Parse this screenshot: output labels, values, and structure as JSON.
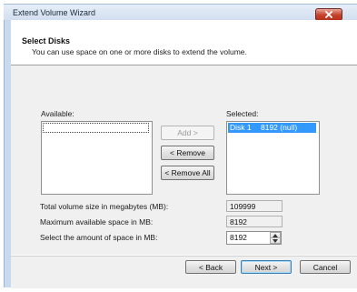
{
  "window": {
    "title": "Extend Volume Wizard"
  },
  "header": {
    "title": "Select Disks",
    "description": "You can use space on one or more disks to extend the volume."
  },
  "available": {
    "label": "Available:",
    "items": []
  },
  "selected": {
    "label": "Selected:",
    "items": [
      {
        "disk": "Disk 1",
        "size": "8192 (null)"
      }
    ]
  },
  "buttons": {
    "add": "Add >",
    "remove": "< Remove",
    "remove_all": "< Remove All",
    "back": "< Back",
    "next": "Next >",
    "cancel": "Cancel"
  },
  "fields": {
    "total_label": "Total volume size in megabytes (MB):",
    "total_value": "109999",
    "max_label": "Maximum available space in MB:",
    "max_value": "8192",
    "amount_label": "Select the amount of space in MB:",
    "amount_value": "8192"
  },
  "icons": {
    "close": "close-icon",
    "spinner_up": "spinner-up-icon",
    "spinner_down": "spinner-down-icon"
  },
  "colors": {
    "selection": "#3399ff",
    "close_button": "#c4412b"
  }
}
